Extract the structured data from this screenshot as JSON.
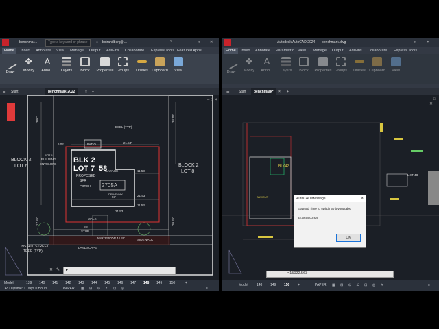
{
  "left": {
    "titlebar": {
      "tab": "benchmar...",
      "search_placeholder": "Type a keyword or phrase",
      "user": "bxtrandberg@..."
    },
    "menu_tabs": [
      "Home",
      "Insert",
      "Annotate",
      "View",
      "Manage",
      "Output",
      "Add-ins",
      "Collaborate",
      "Express Tools",
      "Featured Apps"
    ],
    "ribbon": [
      "Draw",
      "Modify",
      "Anno...",
      "Layers",
      "Block",
      "Properties",
      "Groups",
      "Utilities",
      "Clipboard",
      "View"
    ],
    "file_tabs": {
      "start": "Start",
      "current": "benchmark-2022",
      "add": "+"
    },
    "drawing": {
      "blk": "BLK 2",
      "lot": "LOT 7",
      "lot_num": "58",
      "block_left": "BLOCK 2",
      "lot_left": "LOT 6",
      "block_right": "BLOCK 2",
      "lot_right": "LOT 8",
      "proposed": "PROPOSED",
      "sfr": "SFR",
      "garage": "GARAGE",
      "patio": "PATIO",
      "porch": "PORCH",
      "bsbl": "BSBL (TYP)",
      "eave": "EAVE",
      "building": "BUILDING",
      "envelope": "ENVELOPE",
      "driveway": "DRIVEWAY",
      "walk": "WALK",
      "ss": "SS",
      "stub": "STUB",
      "landscape": "LANDSCAPE",
      "sidewalk": "SIDEWALK",
      "street_tree_1": "INSTALL STREET",
      "street_tree_2": "TREE (TYP)",
      "dim_2153a": "21.53'",
      "dim_2153b": "21.53'",
      "dim_2153c": "21.53'",
      "dim_1153a": "11.53'",
      "dim_1153b": "11.53'",
      "dim_602": "6.02'",
      "dim_380": "38.0'",
      "dim_3410": "34.10'",
      "dim_1785": "17.85'",
      "dim_2035": "20.35'",
      "dim_23": "23'",
      "bearing": "N89°32'50\"W  44.32'",
      "box_code": "2705A"
    },
    "status": {
      "uptime": "CPU Uptime: 1 Days 0 Hours",
      "tabs": [
        "Model",
        "139",
        "140",
        "141",
        "142",
        "143",
        "144",
        "145",
        "146",
        "147",
        "148",
        "149",
        "150"
      ],
      "current": "148",
      "paper": "PAPER"
    }
  },
  "right": {
    "titlebar": {
      "app": "Autodesk AutoCAD 2024",
      "file": "benchmark.dwg"
    },
    "menu_tabs": [
      "Home",
      "Insert",
      "Annotate",
      "Parametric",
      "View",
      "Manage",
      "Output",
      "Add-ins",
      "Collaborate",
      "Express Tools"
    ],
    "ribbon": [
      "Draw",
      "Modify",
      "Anno...",
      "Layers",
      "Block",
      "Properties",
      "Groups",
      "Utilities",
      "Clipboard",
      "View"
    ],
    "file_tabs": {
      "start": "Start",
      "current": "benchmark*",
      "add": "+"
    },
    "dialog": {
      "title": "AutoCAD Message",
      "message": "Elapsed Time to switch 50 layout tabs",
      "value": "32.56Seconds",
      "ok": "OK",
      "close": "×"
    },
    "drawing": {
      "lot_label": "LOT 4B",
      "sawcut": "SAWCUT",
      "blk": "BLK42"
    },
    "command_value": "=15022.563",
    "status": {
      "tabs": [
        "Model",
        "148",
        "149",
        "150"
      ],
      "current": "150",
      "paper": "PAPER"
    }
  },
  "colors": {
    "accent_red": "#e03a3a",
    "ribbon_bg": "#3b424d",
    "canvas_bg": "#1b1f26"
  }
}
